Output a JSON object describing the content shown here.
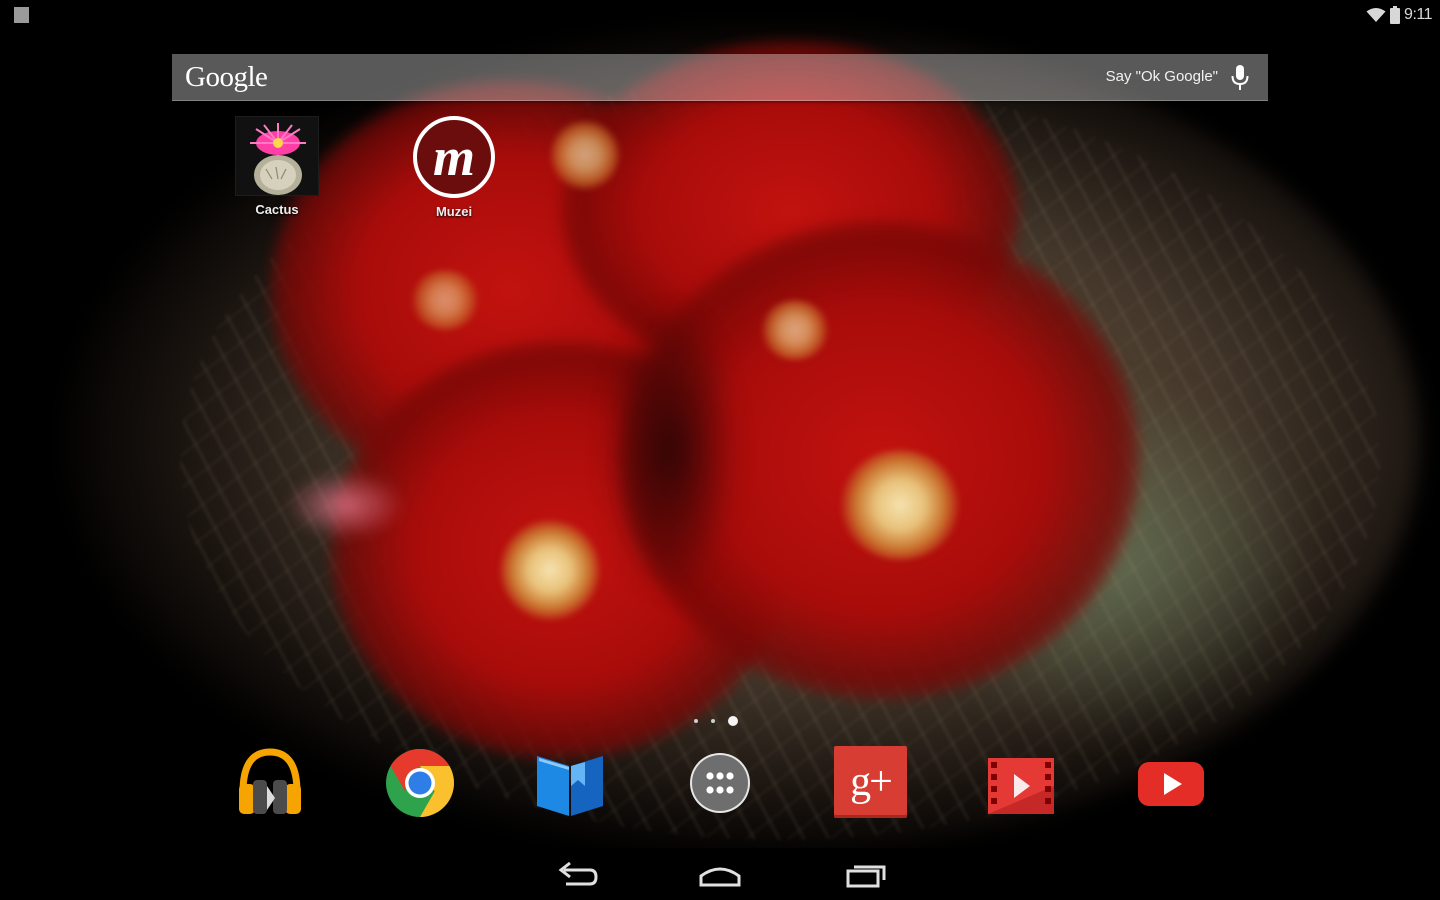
{
  "status_bar": {
    "time": "9:11",
    "icons": [
      "notification-icon",
      "wifi-icon",
      "battery-icon"
    ]
  },
  "search": {
    "logo": "Google",
    "hint": "Say \"Ok Google\"",
    "icon": "mic-icon"
  },
  "shortcuts": [
    {
      "label": "Cactus",
      "icon": "cactus-icon"
    },
    {
      "label": "Muzei",
      "icon": "muzei-icon",
      "glyph": "m"
    }
  ],
  "page_indicator": {
    "pages": 3,
    "current": 3
  },
  "dock": [
    {
      "app": "play-music-icon"
    },
    {
      "app": "chrome-icon"
    },
    {
      "app": "play-books-icon"
    },
    {
      "app": "app-drawer-icon"
    },
    {
      "app": "google-plus-icon",
      "glyph": "g+"
    },
    {
      "app": "play-movies-icon"
    },
    {
      "app": "youtube-icon"
    }
  ],
  "nav": [
    "back-icon",
    "home-icon",
    "recents-icon"
  ],
  "colors": {
    "gplus_red": "#d73d32",
    "youtube_red": "#e52d27",
    "books_blue": "#1e88e5",
    "music_orange": "#f6a500",
    "muzei_ring": "#ffffff"
  }
}
